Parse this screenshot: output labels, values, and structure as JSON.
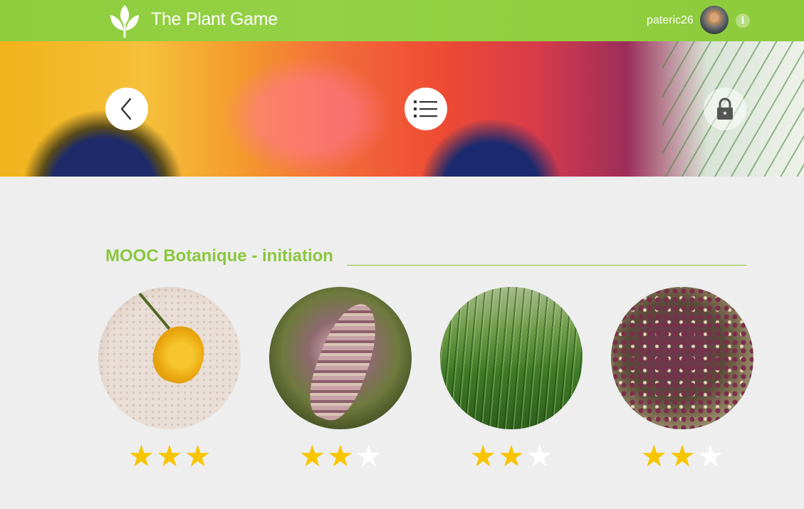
{
  "header": {
    "app_title": "The Plant Game",
    "username": "pateric26",
    "info_label": "i"
  },
  "icons": {
    "logo": "plant-sprout-icon",
    "back": "chevron-left-icon",
    "list": "list-icon",
    "lock": "lock-icon",
    "info": "info-icon",
    "star": "star-icon"
  },
  "colors": {
    "topbar": "#8fcd3c",
    "accent_green": "#8cc63f",
    "star_on": "#f6c500",
    "star_off": "#ffffff",
    "background": "#eeeeee"
  },
  "section": {
    "title": "MOOC Botanique - initiation"
  },
  "cards": [
    {
      "photo": "yellow-flower-photo",
      "stars_earned": 3,
      "stars_total": 3
    },
    {
      "photo": "grass-spike-photo",
      "stars_earned": 2,
      "stars_total": 3
    },
    {
      "photo": "meadow-plantain-photo",
      "stars_earned": 2,
      "stars_total": 3
    },
    {
      "photo": "dark-inflorescence-photo",
      "stars_earned": 2,
      "stars_total": 3
    }
  ]
}
